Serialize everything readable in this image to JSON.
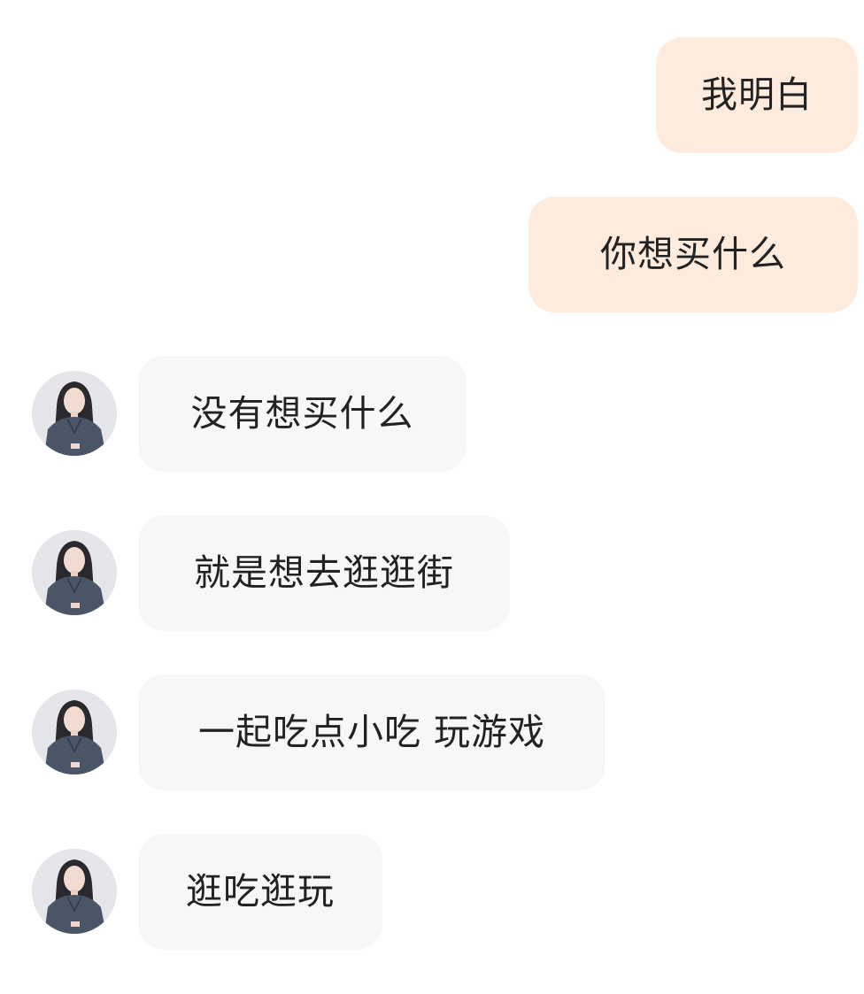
{
  "chat": {
    "outgoing": [
      {
        "text": "我明白"
      },
      {
        "text": "你想买什么"
      }
    ],
    "incoming": [
      {
        "text": "没有想买什么"
      },
      {
        "text": "就是想去逛逛街"
      },
      {
        "text": "一起吃点小吃 玩游戏"
      },
      {
        "text": "逛吃逛玩"
      }
    ]
  },
  "colors": {
    "outgoing_bubble": "#fdebde",
    "incoming_bubble": "#f7f7f7",
    "text": "#222222"
  }
}
